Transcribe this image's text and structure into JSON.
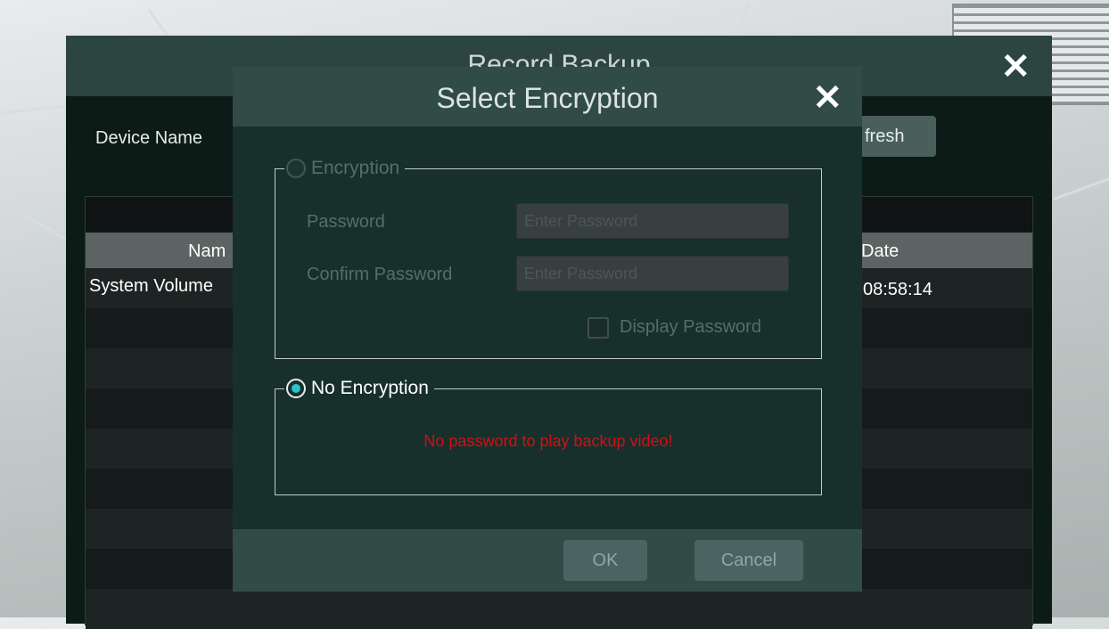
{
  "record_backup": {
    "title": "Record Backup",
    "device_name_label": "Device Name",
    "refresh_label": "fresh",
    "table": {
      "columns": [
        "Nam",
        "Date"
      ],
      "rows": [
        {
          "name": "System Volume",
          "date": "08:58:14"
        }
      ]
    }
  },
  "dialog": {
    "title": "Select Encryption",
    "encryption": {
      "label": "Encryption",
      "selected": false,
      "password_label": "Password",
      "password_placeholder": "Enter Password",
      "confirm_label": "Confirm Password",
      "confirm_placeholder": "Enter Password",
      "display_password_label": "Display Password"
    },
    "no_encryption": {
      "label": "No Encryption",
      "selected": true,
      "warning": "No password to play backup video!"
    },
    "ok_label": "OK",
    "cancel_label": "Cancel"
  },
  "colors": {
    "accent": "#28c4c8",
    "warning": "#d40e15",
    "dialog_bg": "#17302b",
    "titlebar_bg": "#314b47"
  },
  "icons": {
    "close": "close-icon"
  }
}
